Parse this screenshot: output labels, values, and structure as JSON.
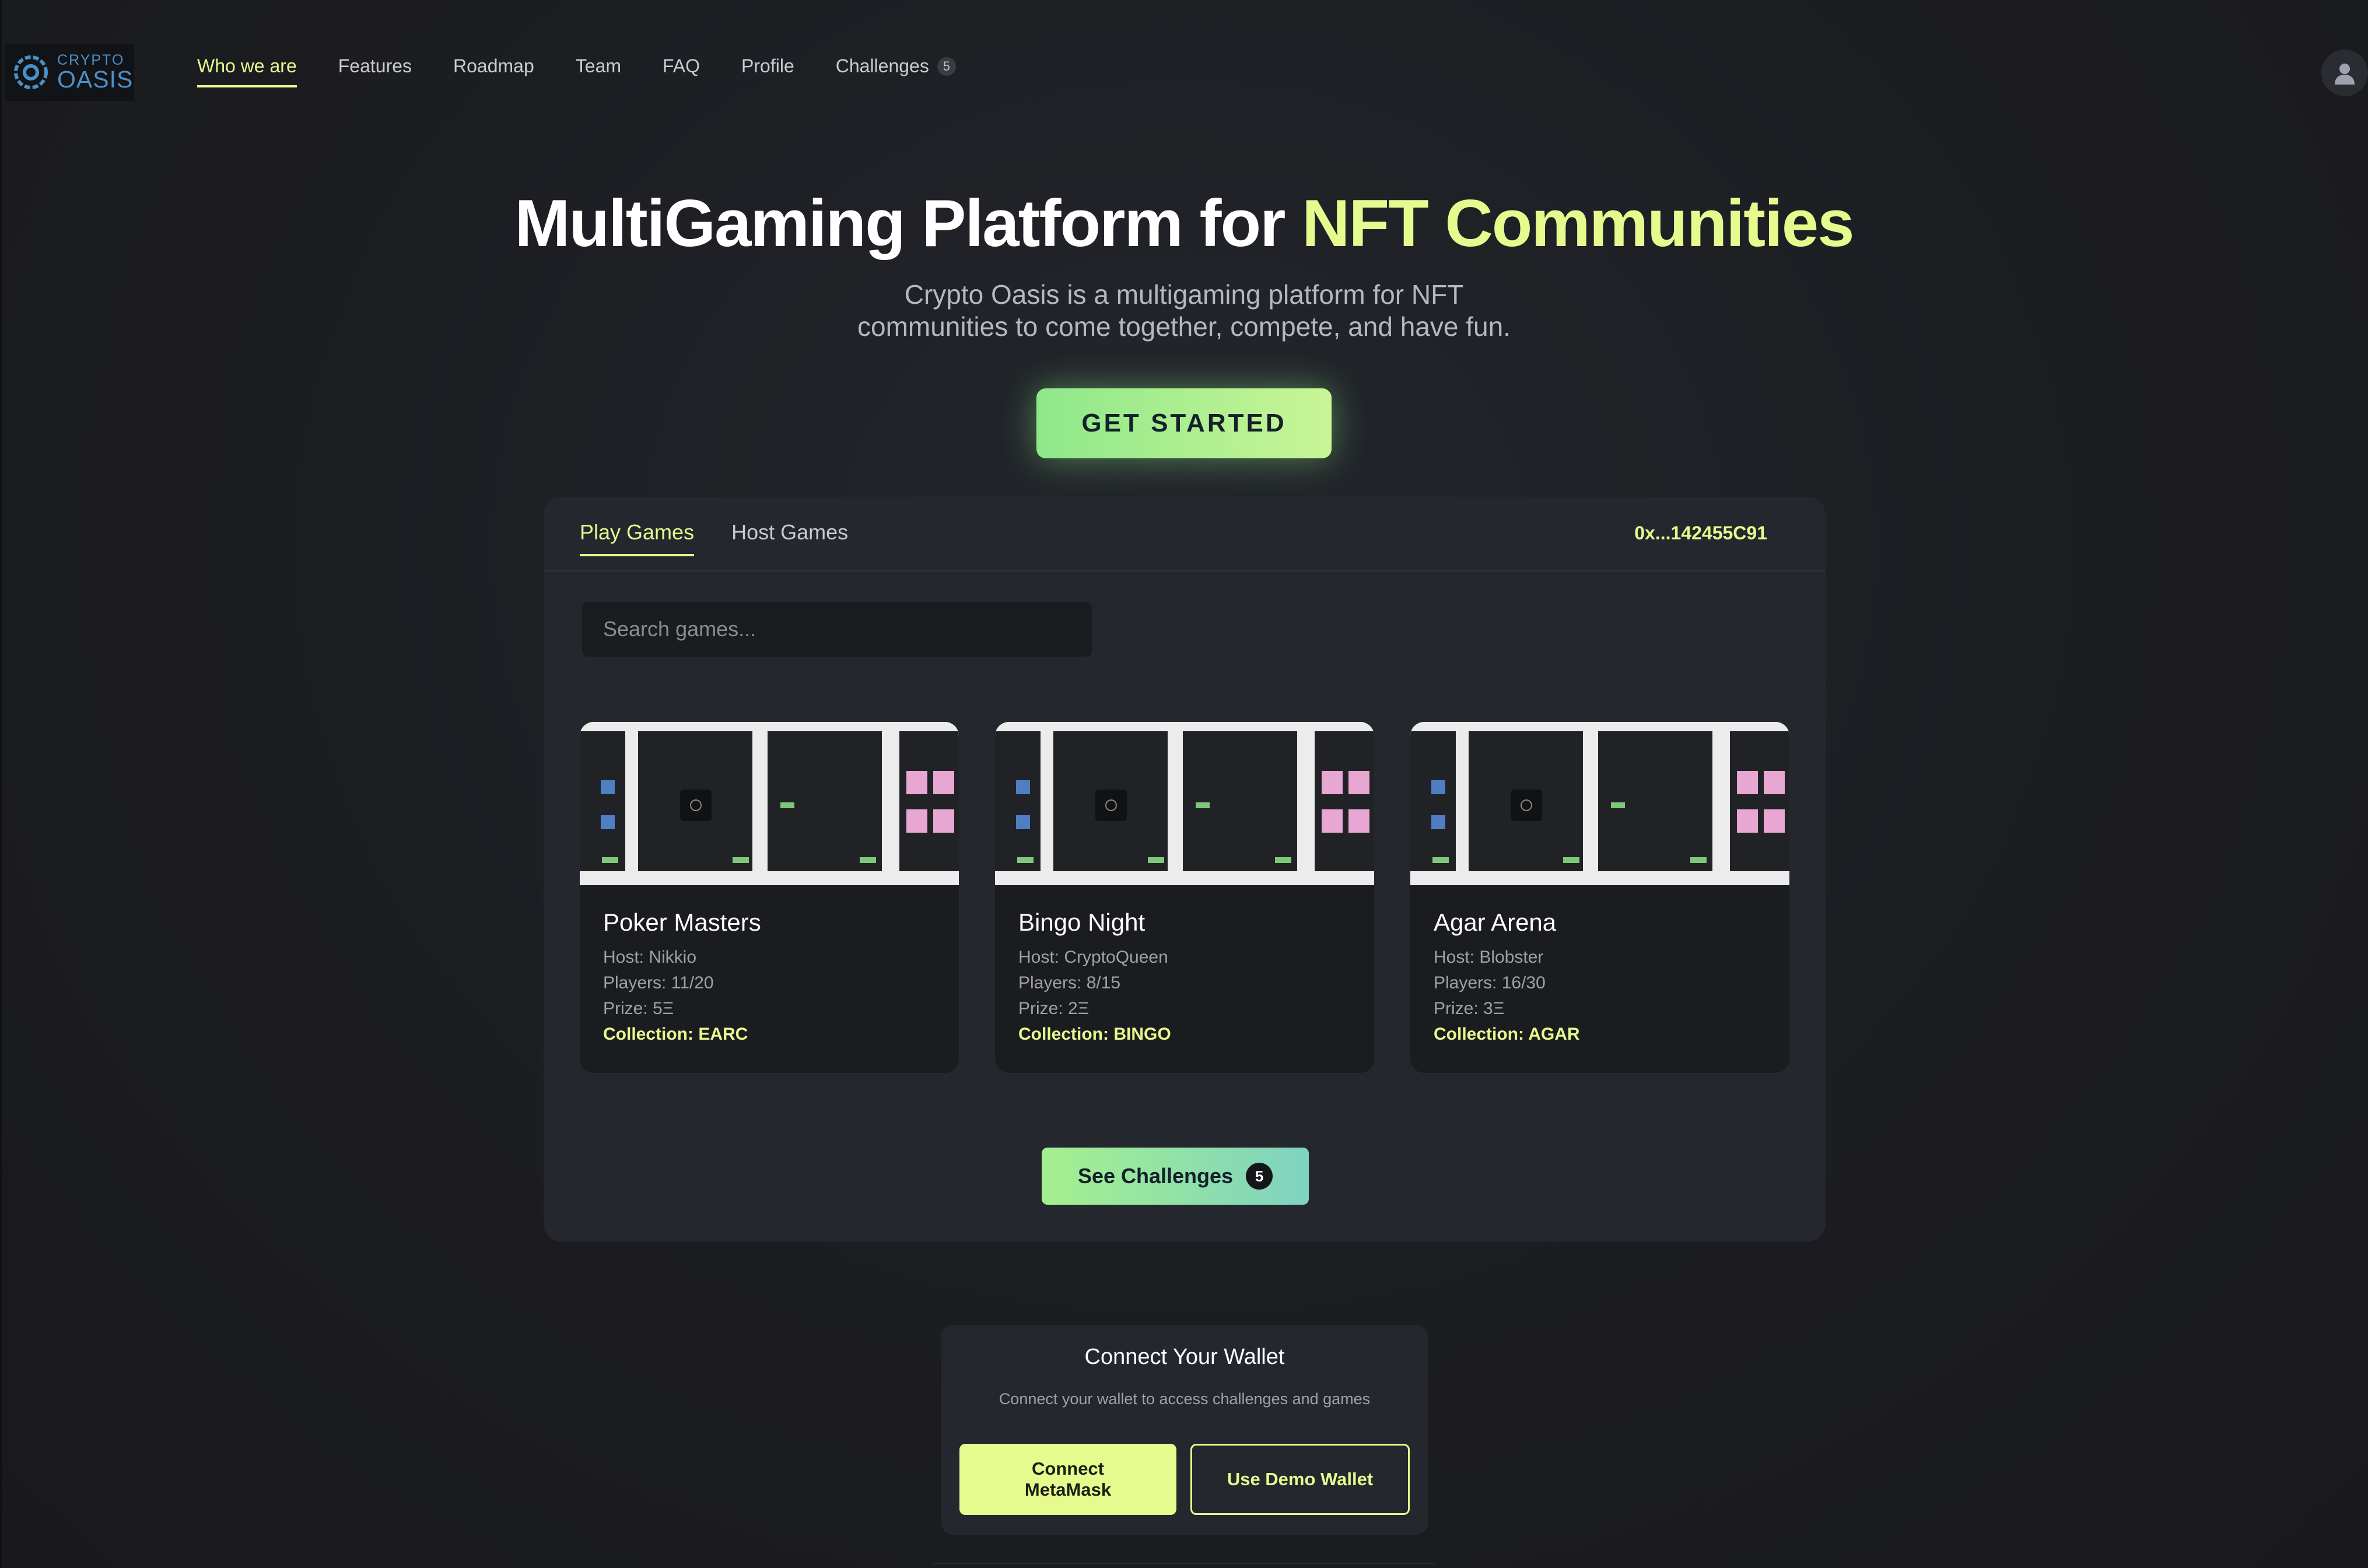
{
  "logo": {
    "line1": "CRYPTO",
    "line2": "OASIS",
    "color": "#4a90c8"
  },
  "nav": {
    "items": [
      {
        "label": "Who we are",
        "active": true
      },
      {
        "label": "Features"
      },
      {
        "label": "Roadmap"
      },
      {
        "label": "Team"
      },
      {
        "label": "FAQ"
      },
      {
        "label": "Profile"
      },
      {
        "label": "Challenges",
        "badge": "5"
      }
    ]
  },
  "avatar": {
    "icon": "user-icon"
  },
  "hero": {
    "title_main": "MultiGaming Platform for ",
    "title_accent": "NFT Communities",
    "subtitle_line1": "Crypto Oasis is a multigaming platform for NFT",
    "subtitle_line2": "communities to come together, compete, and have fun.",
    "cta_label": "GET STARTED"
  },
  "panel": {
    "tabs": [
      {
        "label": "Play Games",
        "active": true
      },
      {
        "label": "Host Games"
      }
    ],
    "wallet_address": "0x...142455C91",
    "search_placeholder": "Search games...",
    "games": [
      {
        "title": "Poker Masters",
        "host": "Host: Nikkio",
        "players": "Players: 11/20",
        "prize": "Prize: 5Ξ",
        "collection": "Collection: EARC"
      },
      {
        "title": "Bingo Night",
        "host": "Host: CryptoQueen",
        "players": "Players: 8/15",
        "prize": "Prize: 2Ξ",
        "collection": "Collection: BINGO"
      },
      {
        "title": "Agar Arena",
        "host": "Host: Blobster",
        "players": "Players: 16/30",
        "prize": "Prize: 3Ξ",
        "collection": "Collection: AGAR"
      }
    ],
    "see_challenges_label": "See Challenges",
    "see_challenges_badge": "5"
  },
  "wallet": {
    "title": "Connect Your Wallet",
    "subtitle": "Connect your wallet to access challenges and games",
    "metamask_label": "Connect MetaMask",
    "demo_label": "Use Demo Wallet"
  },
  "colors": {
    "accent": "#e6fa8e",
    "background": "#1c1d21",
    "panel": "#24272e",
    "cta_gradient_start": "#8ee88a",
    "cta_gradient_end": "#c9f596"
  }
}
